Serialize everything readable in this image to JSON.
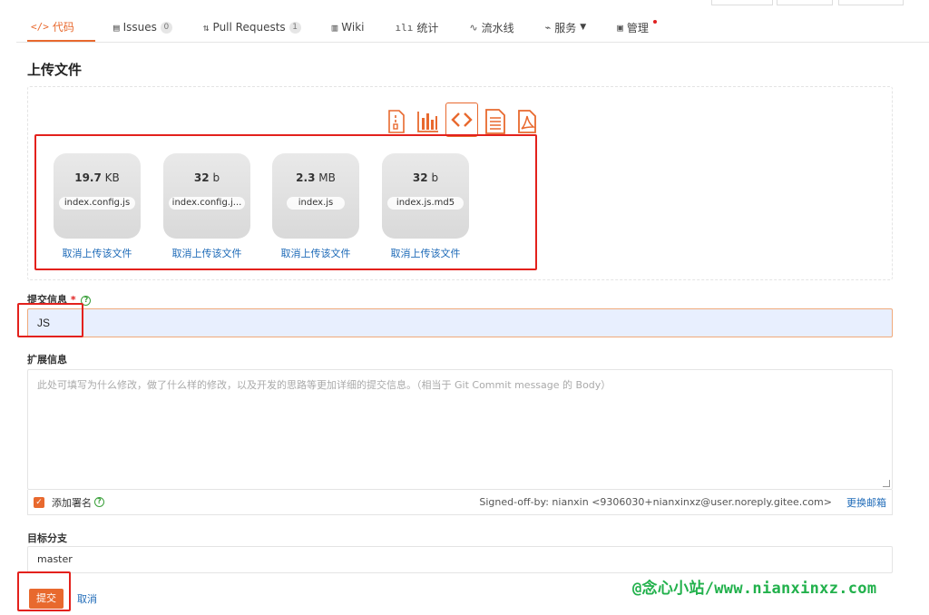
{
  "tabs": [
    {
      "icon": "</>",
      "label": "代码",
      "badge": ""
    },
    {
      "icon": "▤",
      "label": "Issues",
      "badge": "0"
    },
    {
      "icon": "⇅",
      "label": "Pull Requests",
      "badge": "1"
    },
    {
      "icon": "▥",
      "label": "Wiki",
      "badge": ""
    },
    {
      "icon": "ılı",
      "label": "统计",
      "badge": ""
    },
    {
      "icon": "∿",
      "label": "流水线",
      "badge": ""
    },
    {
      "icon": "⌁",
      "label": "服务",
      "badge": ""
    },
    {
      "icon": "▣",
      "label": "管理",
      "badge": ""
    }
  ],
  "page_title": "上传文件",
  "files": [
    {
      "size_num": "19.7",
      "size_unit": "KB",
      "name": "index.config.js",
      "cancel": "取消上传该文件"
    },
    {
      "size_num": "32",
      "size_unit": "b",
      "name": "index.config.j...",
      "cancel": "取消上传该文件"
    },
    {
      "size_num": "2.3",
      "size_unit": "MB",
      "name": "index.js",
      "cancel": "取消上传该文件"
    },
    {
      "size_num": "32",
      "size_unit": "b",
      "name": "index.js.md5",
      "cancel": "取消上传该文件"
    }
  ],
  "commit": {
    "label": "提交信息",
    "required_mark": "*",
    "help": "?",
    "value": "JS"
  },
  "ext": {
    "label": "扩展信息",
    "placeholder": "此处可填写为什么修改，做了什么样的修改，以及开发的思路等更加详细的提交信息。（相当于 Git Commit message 的 Body）"
  },
  "signoff": {
    "check": "✓",
    "label": "添加署名",
    "help": "?",
    "info": "Signed-off-by: nianxin <9306030+nianxinxz@user.noreply.gitee.com>",
    "change_email": "更换邮箱"
  },
  "branch": {
    "label": "目标分支",
    "value": "master"
  },
  "actions": {
    "submit": "提交",
    "cancel": "取消"
  },
  "watermark": "@念心小站/www.nianxinxz.com",
  "colors": {
    "accent": "#e8692e",
    "link": "#1f6bb8",
    "highlight_box": "#e3211c",
    "watermark": "#22b14c"
  }
}
